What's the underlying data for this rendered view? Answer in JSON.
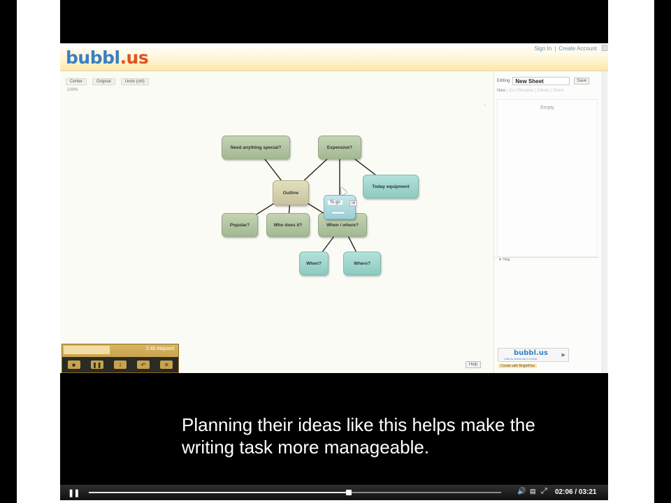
{
  "app": {
    "logo_main": "bubbl",
    "logo_suffix": ".us",
    "account": {
      "sign_in": "Sign In",
      "separator": "|",
      "create_account": "Create Account"
    },
    "toolbar": [
      "Center",
      "Original",
      "Undo (ctrl)"
    ],
    "zoom_text": "100%"
  },
  "mindmap": {
    "nodes": [
      {
        "id": "need",
        "label": "Need anything special?",
        "style": "g"
      },
      {
        "id": "expensive",
        "label": "Expensive?",
        "style": "g"
      },
      {
        "id": "outline",
        "label": "Outline",
        "style": "c"
      },
      {
        "id": "popular",
        "label": "Popular?",
        "style": "g"
      },
      {
        "id": "whodoes",
        "label": "Who does it?",
        "style": "g"
      },
      {
        "id": "whenwhere",
        "label": "When / where?",
        "style": "g"
      },
      {
        "id": "today",
        "label": "Today equipment",
        "style": "t"
      },
      {
        "id": "when",
        "label": "When?",
        "style": "t"
      },
      {
        "id": "where",
        "label": "Where?",
        "style": "t"
      }
    ],
    "edges": [
      [
        "outline",
        "need"
      ],
      [
        "outline",
        "expensive"
      ],
      [
        "outline",
        "popular"
      ],
      [
        "outline",
        "whodoes"
      ],
      [
        "outline",
        "whenwhere"
      ],
      [
        "expensive",
        "today"
      ],
      [
        "whenwhere",
        "when"
      ],
      [
        "whenwhere",
        "where"
      ],
      [
        "expensive",
        "popup"
      ]
    ],
    "edit_popup": {
      "text": "To go"
    }
  },
  "sidebar": {
    "editing_label": "Editing",
    "sheet_name": "New Sheet",
    "save_label": "Save",
    "actions": {
      "new": "New",
      "rest": "| Go | Rename | Delete | Share"
    },
    "empty_label": "Empty",
    "help_header": "▼ Help",
    "promo": {
      "logo": "bubbl.us",
      "sub": "Click to check out 2.0 beta",
      "badge": "Create with BrightFlux"
    }
  },
  "canvas_help": "Help",
  "player_widget": {
    "time": "2:40 elapsed"
  },
  "video": {
    "subtitle": "Planning their ideas like this helps make the writing task more manageable.",
    "time_current": "02:06",
    "time_total": "03:21",
    "progress": 0.63
  }
}
